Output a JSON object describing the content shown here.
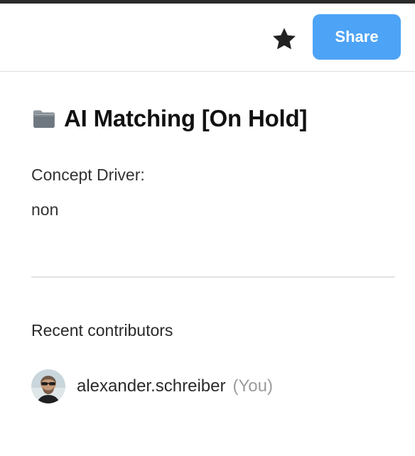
{
  "header": {
    "star_icon": "star-icon",
    "share_label": "Share",
    "share_color": "#4da3f5"
  },
  "page": {
    "icon": "folder-icon",
    "title": "AI Matching [On Hold]",
    "concept_driver_label": "Concept Driver:",
    "concept_driver_value": "non"
  },
  "contributors": {
    "heading": "Recent contributors",
    "items": [
      {
        "avatar": "avatar",
        "name": "alexander.schreiber",
        "you_label": "(You)"
      }
    ]
  }
}
